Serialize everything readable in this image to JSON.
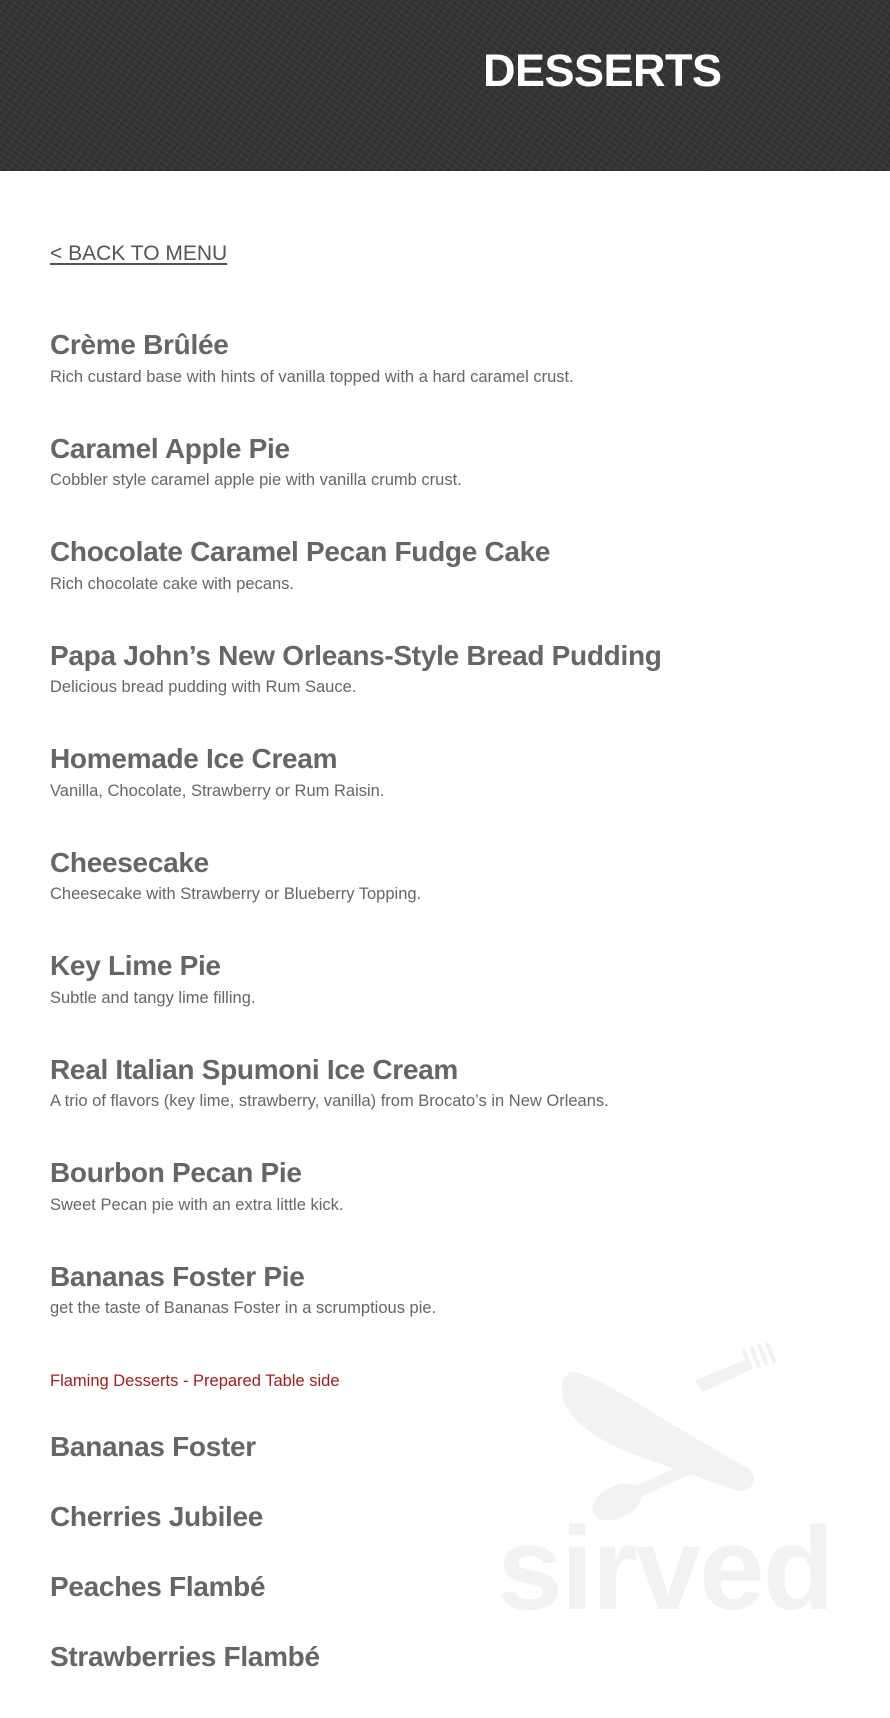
{
  "header": {
    "title": "DESSERTS"
  },
  "nav": {
    "back_label": "< BACK TO MENU"
  },
  "items": [
    {
      "name": "Crème Brûlée",
      "desc": "Rich custard base with hints of vanilla topped with a hard caramel crust."
    },
    {
      "name": "Caramel Apple Pie",
      "desc": "Cobbler style caramel apple pie with vanilla crumb crust."
    },
    {
      "name": "Chocolate Caramel Pecan Fudge Cake",
      "desc": "Rich chocolate cake with pecans."
    },
    {
      "name": "Papa John’s New Orleans-Style Bread Pudding",
      "desc": "Delicious bread pudding with Rum Sauce."
    },
    {
      "name": "Homemade Ice Cream",
      "desc": "Vanilla, Chocolate, Strawberry or Rum Raisin."
    },
    {
      "name": "Cheesecake",
      "desc": "Cheesecake with Strawberry or Blueberry Topping."
    },
    {
      "name": "Key Lime Pie",
      "desc": "Subtle and tangy lime filling."
    },
    {
      "name": "Real Italian Spumoni Ice Cream",
      "desc": "A trio of flavors (key lime, strawberry, vanilla) from Brocato’s in New Orleans."
    },
    {
      "name": "Bourbon Pecan Pie",
      "desc": "Sweet Pecan pie with an extra little kick."
    },
    {
      "name": "Bananas Foster Pie",
      "desc": "get the taste of Bananas Foster in a scrumptious pie."
    }
  ],
  "flaming_section": {
    "label": "Flaming Desserts - Prepared Table side",
    "items": [
      "Bananas Foster",
      "Cherries Jubilee",
      "Peaches Flambé",
      "Strawberries Flambé"
    ]
  },
  "watermark": {
    "text": "sirved",
    "icon": "utensils-icon"
  },
  "colors": {
    "header_bg": "#333333",
    "text": "#666666",
    "section_label": "#a01e1e",
    "watermark": "#f2f2f2"
  }
}
